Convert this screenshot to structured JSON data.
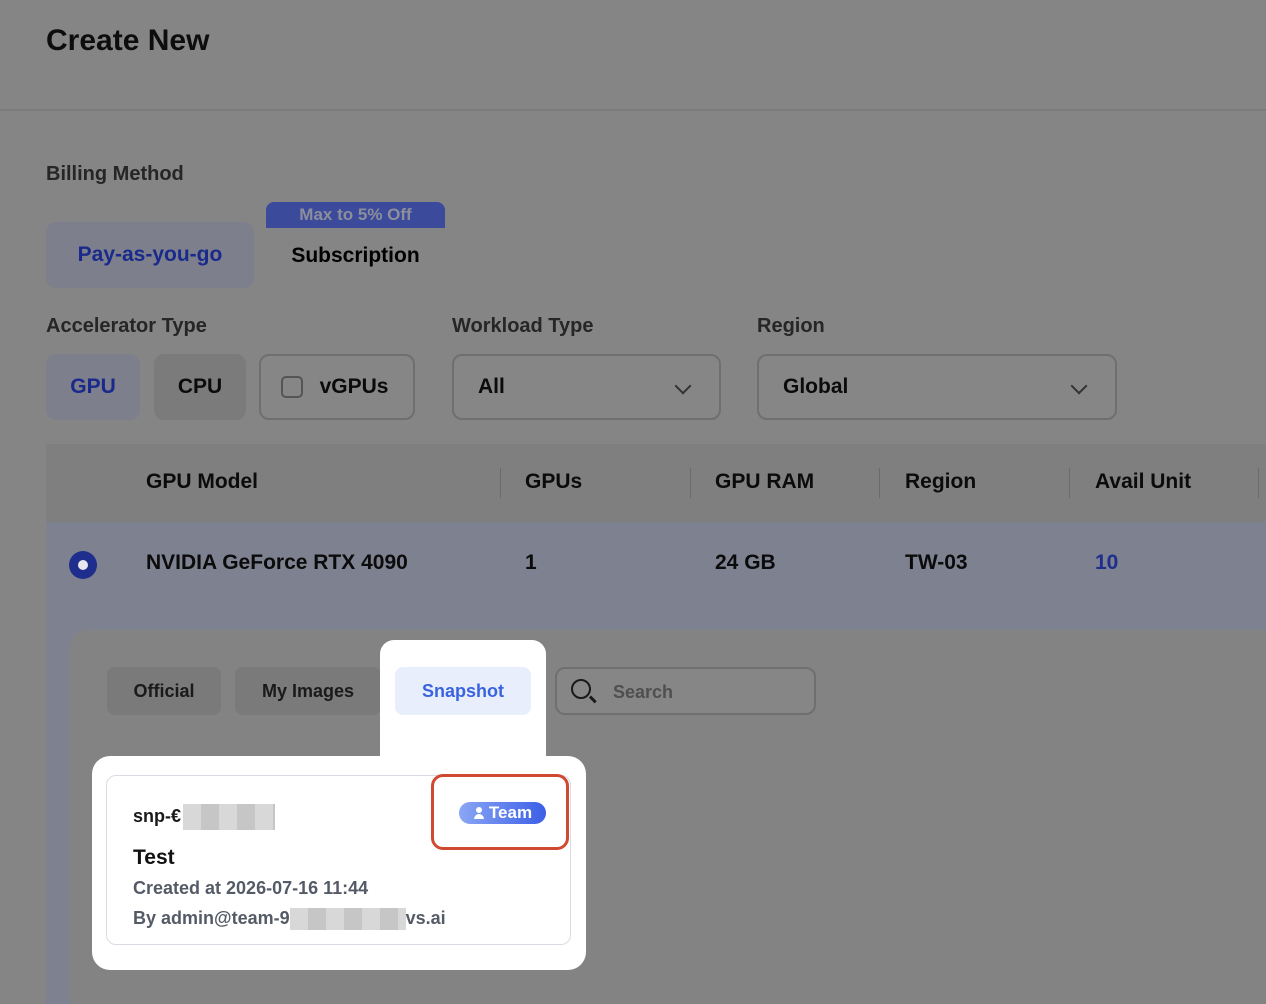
{
  "header": {
    "title": "Create New"
  },
  "billing": {
    "label": "Billing Method",
    "options": [
      {
        "label": "Pay-as-you-go",
        "selected": true
      },
      {
        "label": "Subscription",
        "selected": false
      }
    ],
    "promo_badge": "Max to 5% Off"
  },
  "filters": {
    "accelerator": {
      "label": "Accelerator Type",
      "options": [
        {
          "label": "GPU",
          "selected": true
        },
        {
          "label": "CPU",
          "selected": false
        }
      ],
      "vgpu_label": "vGPUs",
      "vgpu_checked": false
    },
    "workload": {
      "label": "Workload Type",
      "value": "All"
    },
    "region": {
      "label": "Region",
      "value": "Global"
    }
  },
  "table": {
    "headers": [
      "GPU Model",
      "GPUs",
      "GPU RAM",
      "Region",
      "Avail Unit"
    ],
    "rows": [
      {
        "selected": true,
        "model": "NVIDIA GeForce RTX 4090",
        "gpus": "1",
        "ram": "24 GB",
        "region": "TW-03",
        "avail": "10"
      }
    ]
  },
  "images": {
    "tabs": [
      {
        "label": "Official",
        "active": false
      },
      {
        "label": "My Images",
        "active": false
      },
      {
        "label": "Snapshot",
        "active": true
      }
    ],
    "search_placeholder": "Search",
    "snapshot_card": {
      "id_prefix": "snp-€",
      "badge": "Team",
      "title": "Test",
      "created": "Created at 2026-07-16 11:44",
      "by_prefix": "By admin@team-9",
      "by_suffix": "vs.ai"
    }
  },
  "colors": {
    "accent": "#3a63e0",
    "callout": "#d04a32",
    "selected_blue": "#1f2e8c"
  }
}
